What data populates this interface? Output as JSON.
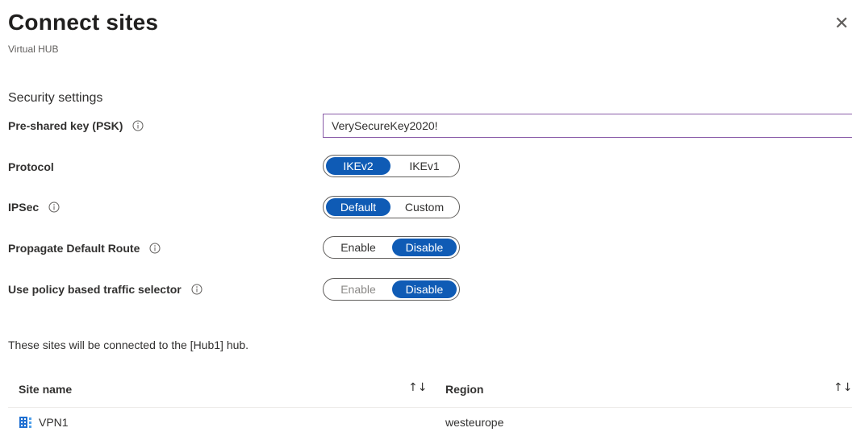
{
  "header": {
    "title": "Connect sites",
    "subtitle": "Virtual HUB",
    "close_icon": "close-icon"
  },
  "security": {
    "section_label": "Security settings",
    "psk_label": "Pre-shared key (PSK)",
    "psk_value": "VerySecureKey2020!",
    "protocol_label": "Protocol",
    "protocol_options": [
      "IKEv2",
      "IKEv1"
    ],
    "protocol_selected": "IKEv2",
    "ipsec_label": "IPSec",
    "ipsec_options": [
      "Default",
      "Custom"
    ],
    "ipsec_selected": "Default",
    "propagate_label": "Propagate Default Route",
    "propagate_options": [
      "Enable",
      "Disable"
    ],
    "propagate_selected": "Disable",
    "policy_label": "Use policy based traffic selector",
    "policy_options": [
      "Enable",
      "Disable"
    ],
    "policy_selected": "Disable"
  },
  "sites": {
    "note": "These sites will be connected to the [Hub1] hub.",
    "columns": [
      "Site name",
      "Region"
    ],
    "sort_icon": "↑↓",
    "rows": [
      {
        "site_name": "VPN1",
        "region": "westeurope",
        "icon": "vpn-site-icon"
      }
    ]
  },
  "colors": {
    "accent": "#0f5bb5",
    "input_border": "#8a5ca8"
  }
}
